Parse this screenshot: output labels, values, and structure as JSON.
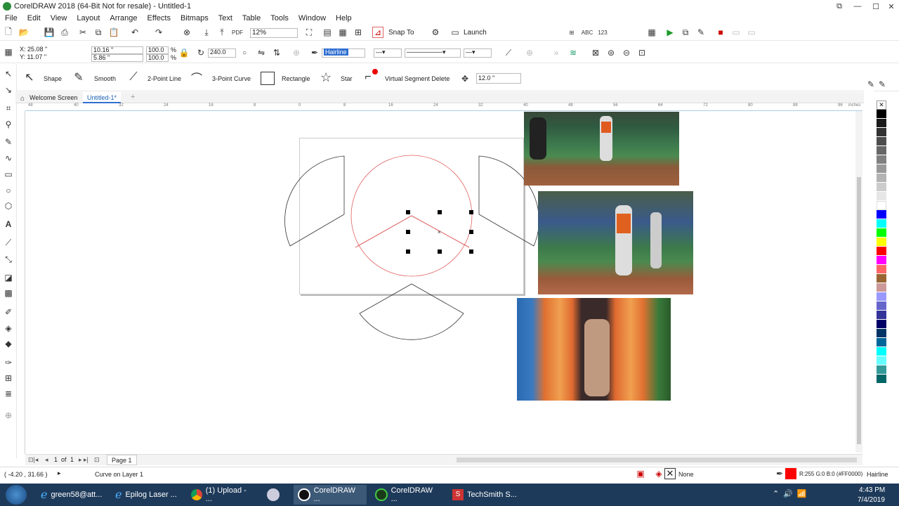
{
  "app": {
    "title": "CorelDRAW 2018 (64-Bit Not for resale) - Untitled-1"
  },
  "menu": [
    "File",
    "Edit",
    "View",
    "Layout",
    "Arrange",
    "Effects",
    "Bitmaps",
    "Text",
    "Table",
    "Tools",
    "Window",
    "Help"
  ],
  "toolbar": {
    "zoom": "12%",
    "snap_to": "Snap To",
    "launch": "Launch"
  },
  "props": {
    "x": "X: 25.08 \"",
    "y": "Y: 11.07 \"",
    "width": "10.16 \"",
    "height": "5.86 \"",
    "scale_w": "100.0",
    "scale_h": "100.0",
    "pct1": "%",
    "pct2": "%",
    "rotation": "240.0",
    "outline": "Hairline"
  },
  "shape_tools": {
    "shape": "Shape",
    "smooth": "Smooth",
    "two_point_line": "2-Point Line",
    "three_point_curve": "3-Point Curve",
    "rectangle": "Rectangle",
    "star": "Star",
    "virtual_segment_delete": "Virtual Segment Delete",
    "nudge": "12.0 \""
  },
  "tabs": {
    "welcome": "Welcome Screen",
    "doc": "Untitled-1*"
  },
  "ruler": {
    "ticks": [
      "48",
      "40",
      "32",
      "24",
      "16",
      "8",
      "0",
      "8",
      "16",
      "24",
      "32",
      "40",
      "48",
      "56",
      "64",
      "72",
      "80",
      "88",
      "96"
    ],
    "unit": "inches"
  },
  "pagebar": {
    "page_num": "1",
    "of": "of",
    "total": "1",
    "page_label": "Page 1"
  },
  "status": {
    "coords": "( -4.20 , 31.66 )",
    "info": "Curve on Layer 1",
    "fill_none": "None",
    "color_info": "R:255 G:0 B:0 (#FF0000)",
    "outline": "Hairline"
  },
  "palette": [
    "#000000",
    "#1a1a1a",
    "#333333",
    "#4d4d4d",
    "#666666",
    "#808080",
    "#999999",
    "#b3b3b3",
    "#cccccc",
    "#e6e6e6",
    "#ffffff",
    "#0000ff",
    "#00ffff",
    "#00ff00",
    "#ffff00",
    "#ff0000",
    "#ff00ff",
    "#ff6666",
    "#996633",
    "#cc9999",
    "#9999ff",
    "#6666cc",
    "#333399",
    "#000066",
    "#003366",
    "#006699",
    "#00ffff",
    "#66ffff",
    "#339999",
    "#006666"
  ],
  "taskbar": {
    "items": [
      "green58@att...",
      "Epilog Laser ...",
      "(1) Upload - ...",
      "CorelDRAW ...",
      "CorelDRAW ...",
      "TechSmith S..."
    ],
    "time": "4:43 PM",
    "date": "7/4/2019"
  }
}
